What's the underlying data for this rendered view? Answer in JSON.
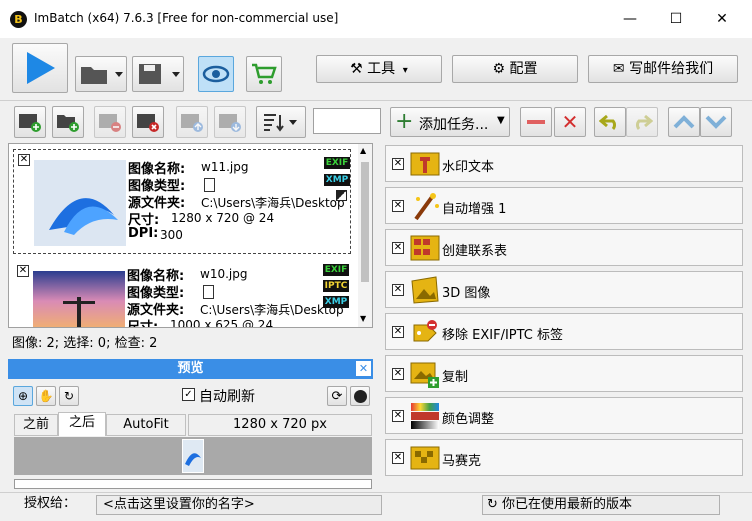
{
  "window": {
    "title": "ImBatch (x64) 7.6.3 [Free for non-commercial use]",
    "logo_letter": "B",
    "min": "—",
    "max": "☐",
    "close": "✕"
  },
  "toolbar": {
    "tools_label": "工具",
    "config_label": "配置",
    "email_label": "写邮件给我们"
  },
  "files": [
    {
      "name_label": "图像名称:",
      "name": "w11.jpg",
      "type_label": "图像类型:",
      "folder_label": "源文件夹:",
      "folder": "C:\\Users\\李海兵\\Desktop",
      "size_label": "尺寸:",
      "size": "1280 x 720 @ 24",
      "dpi_label": "DPI:",
      "dpi": "300",
      "badges": [
        "EXIF",
        "XMP"
      ]
    },
    {
      "name_label": "图像名称:",
      "name": "w10.jpg",
      "type_label": "图像类型:",
      "folder_label": "源文件夹:",
      "folder": "C:\\Users\\李海兵\\Desktop",
      "size_label": "尺寸:",
      "size": "1000 x 625 @ 24",
      "badges": [
        "EXIF",
        "IPTC",
        "XMP"
      ]
    }
  ],
  "file_status": "图像: 2; 选择: 0; 检查: 2",
  "tasks": {
    "add_label": "添加任务...",
    "items": [
      {
        "name": "水印文本"
      },
      {
        "name": "自动增强 1"
      },
      {
        "name": "创建联系表"
      },
      {
        "name": "3D 图像"
      },
      {
        "name": "移除 EXIF/IPTC 标签"
      },
      {
        "name": "复制"
      },
      {
        "name": "颜色调整"
      },
      {
        "name": "马赛克"
      }
    ]
  },
  "preview": {
    "title": "预览",
    "auto_refresh": "自动刷新",
    "tab_before": "之前",
    "tab_after": "之后",
    "autofit": "AutoFit",
    "dimensions": "1280 x 720 px"
  },
  "statusbar": {
    "license_label": "授权给：",
    "license_value": "<点击这里设置你的名字>",
    "version_text": "你已在使用最新的版本"
  },
  "colors": {
    "accent": "#3a8ee6",
    "play": "#1e88e5",
    "remove": "#e53935",
    "add": "#2e7d32"
  }
}
